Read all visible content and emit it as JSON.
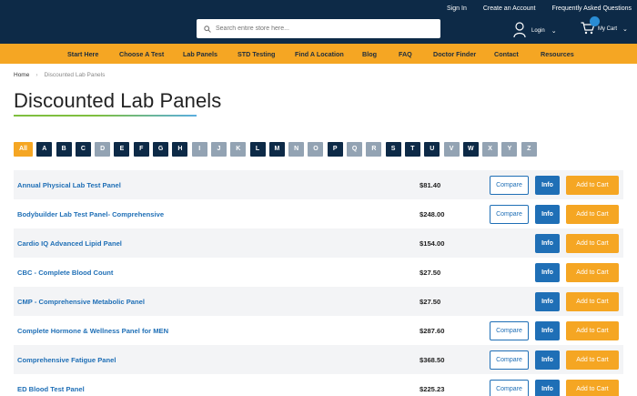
{
  "header": {
    "top_links": [
      "Sign In",
      "Create an Account",
      "Frequently Asked Questions"
    ],
    "search_placeholder": "Search entire store here...",
    "login_label": "Login",
    "cart_label": "My Cart"
  },
  "nav": {
    "items": [
      "Start Here",
      "Choose A Test",
      "Lab Panels",
      "STD Testing",
      "Find A Location",
      "Blog",
      "FAQ",
      "Doctor Finder",
      "Contact",
      "Resources"
    ]
  },
  "breadcrumb": {
    "home": "Home",
    "separator": "›",
    "current": "Discounted Lab Panels"
  },
  "page_title": "Discounted Lab Panels",
  "alphabet": {
    "all_label": "All",
    "letters": [
      {
        "l": "A",
        "active": true
      },
      {
        "l": "B",
        "active": true
      },
      {
        "l": "C",
        "active": true
      },
      {
        "l": "D",
        "active": false
      },
      {
        "l": "E",
        "active": true
      },
      {
        "l": "F",
        "active": true
      },
      {
        "l": "G",
        "active": true
      },
      {
        "l": "H",
        "active": true
      },
      {
        "l": "I",
        "active": false
      },
      {
        "l": "J",
        "active": false
      },
      {
        "l": "K",
        "active": false
      },
      {
        "l": "L",
        "active": true
      },
      {
        "l": "M",
        "active": true
      },
      {
        "l": "N",
        "active": false
      },
      {
        "l": "O",
        "active": false
      },
      {
        "l": "P",
        "active": true
      },
      {
        "l": "Q",
        "active": false
      },
      {
        "l": "R",
        "active": false
      },
      {
        "l": "S",
        "active": true
      },
      {
        "l": "T",
        "active": true
      },
      {
        "l": "U",
        "active": true
      },
      {
        "l": "V",
        "active": false
      },
      {
        "l": "W",
        "active": true
      },
      {
        "l": "X",
        "active": false
      },
      {
        "l": "Y",
        "active": false
      },
      {
        "l": "Z",
        "active": false
      }
    ]
  },
  "buttons": {
    "compare": "Compare",
    "info": "Info",
    "add_to_cart": "Add to Cart"
  },
  "products": [
    {
      "name": "Annual Physical Lab Test Panel",
      "price": "$81.40",
      "compare": true
    },
    {
      "name": "Bodybuilder Lab Test Panel- Comprehensive",
      "price": "$248.00",
      "compare": true
    },
    {
      "name": "Cardio IQ Advanced Lipid Panel",
      "price": "$154.00",
      "compare": false
    },
    {
      "name": "CBC - Complete Blood Count",
      "price": "$27.50",
      "compare": false
    },
    {
      "name": "CMP - Comprehensive Metabolic Panel",
      "price": "$27.50",
      "compare": false
    },
    {
      "name": "Complete Hormone & Wellness Panel for MEN",
      "price": "$287.60",
      "compare": true
    },
    {
      "name": "Comprehensive Fatigue Panel",
      "price": "$368.50",
      "compare": true
    },
    {
      "name": "ED Blood Test Panel",
      "price": "$225.23",
      "compare": true
    }
  ],
  "colors": {
    "header_bg": "#0d2a47",
    "nav_bg": "#f5a623",
    "link": "#1f6fb6",
    "inactive_letter": "#93a3b3"
  },
  "icons": [
    "search-icon",
    "user-icon",
    "cart-icon",
    "chevron-down-icon"
  ]
}
